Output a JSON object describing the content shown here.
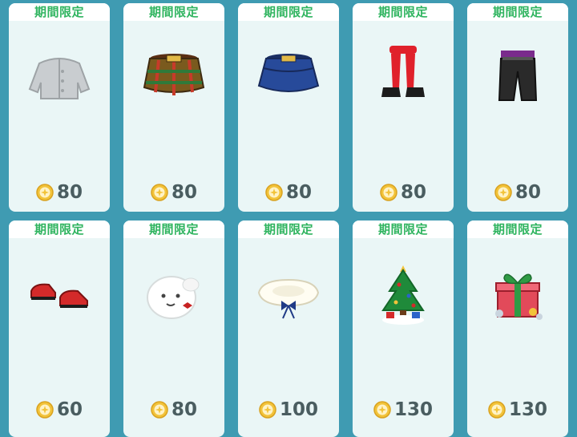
{
  "items": [
    {
      "tag": "期間限定",
      "price": "80",
      "art": "gray-cardigan-icon"
    },
    {
      "tag": "期間限定",
      "price": "80",
      "art": "plaid-skirt-icon"
    },
    {
      "tag": "期間限定",
      "price": "80",
      "art": "navy-skirt-icon"
    },
    {
      "tag": "期間限定",
      "price": "80",
      "art": "red-tights-heels-icon"
    },
    {
      "tag": "期間限定",
      "price": "80",
      "art": "black-pants-icon"
    },
    {
      "tag": "期間限定",
      "price": "60",
      "art": "red-shoes-icon"
    },
    {
      "tag": "期間限定",
      "price": "80",
      "art": "white-ghost-hat-icon"
    },
    {
      "tag": "期間限定",
      "price": "100",
      "art": "fur-collar-bow-icon"
    },
    {
      "tag": "期間限定",
      "price": "130",
      "art": "christmas-tree-icon"
    },
    {
      "tag": "期間限定",
      "price": "130",
      "art": "gift-box-icon"
    }
  ],
  "colors": {
    "tag_text": "#2fb45f",
    "price_text": "#4a5d60",
    "coin": "#f2c33a",
    "card_bg": "#eaf6f6"
  }
}
